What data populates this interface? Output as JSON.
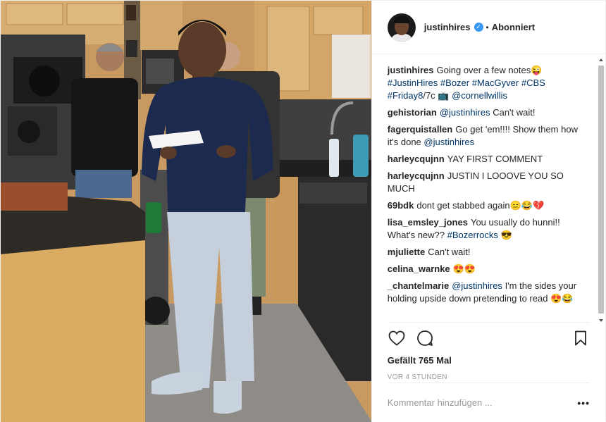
{
  "header": {
    "username": "justinhires",
    "separator": "•",
    "follow_status": "Abonniert"
  },
  "caption": {
    "username": "justinhires",
    "text": "Going over a few notes😜",
    "hashtags": [
      "#JustinHires",
      "#Bozer",
      "#MacGyver",
      "#CBS",
      "#Friday8"
    ],
    "tail": "/7c 📺",
    "mention": "@cornellwillis"
  },
  "comments": [
    {
      "username": "gehistorian",
      "mention": "@justinhires",
      "text": "Can't wait!"
    },
    {
      "username": "fagerquistallen",
      "text": "Go get 'em!!!! Show them how it's done",
      "mention": "@justinhires"
    },
    {
      "username": "harleycqujnn",
      "text": "YAY FIRST COMMENT"
    },
    {
      "username": "harleycqujnn",
      "text": "JUSTIN I LOOOVE YOU SO MUCH"
    },
    {
      "username": "69bdk",
      "text": "dont get stabbed again😑😂💔"
    },
    {
      "username": "lisa_emsley_jones",
      "text": "You usually do hunni!! What's new??",
      "hashtag": "#Bozerrocks",
      "emoji": "😎"
    },
    {
      "username": "mjuliette",
      "text": "Can't wait!"
    },
    {
      "username": "celina_warnke",
      "text": "😍😍"
    },
    {
      "username": "_chantelmarie",
      "mention": "@justinhires",
      "text": "I'm the sides your holding upside down pretending to read 😍😂"
    }
  ],
  "likes": "Gefällt 765 Mal",
  "timestamp": "VOR 4 STUNDEN",
  "comment_input": {
    "placeholder": "Kommentar hinzufügen ...",
    "more": "•••"
  },
  "icons": {
    "like": "heart-icon",
    "comment": "comment-bubble-icon",
    "save": "bookmark-icon",
    "verified": "verified-badge-icon"
  },
  "colors": {
    "link": "#003569",
    "verified": "#3897f0",
    "muted": "#999999"
  }
}
